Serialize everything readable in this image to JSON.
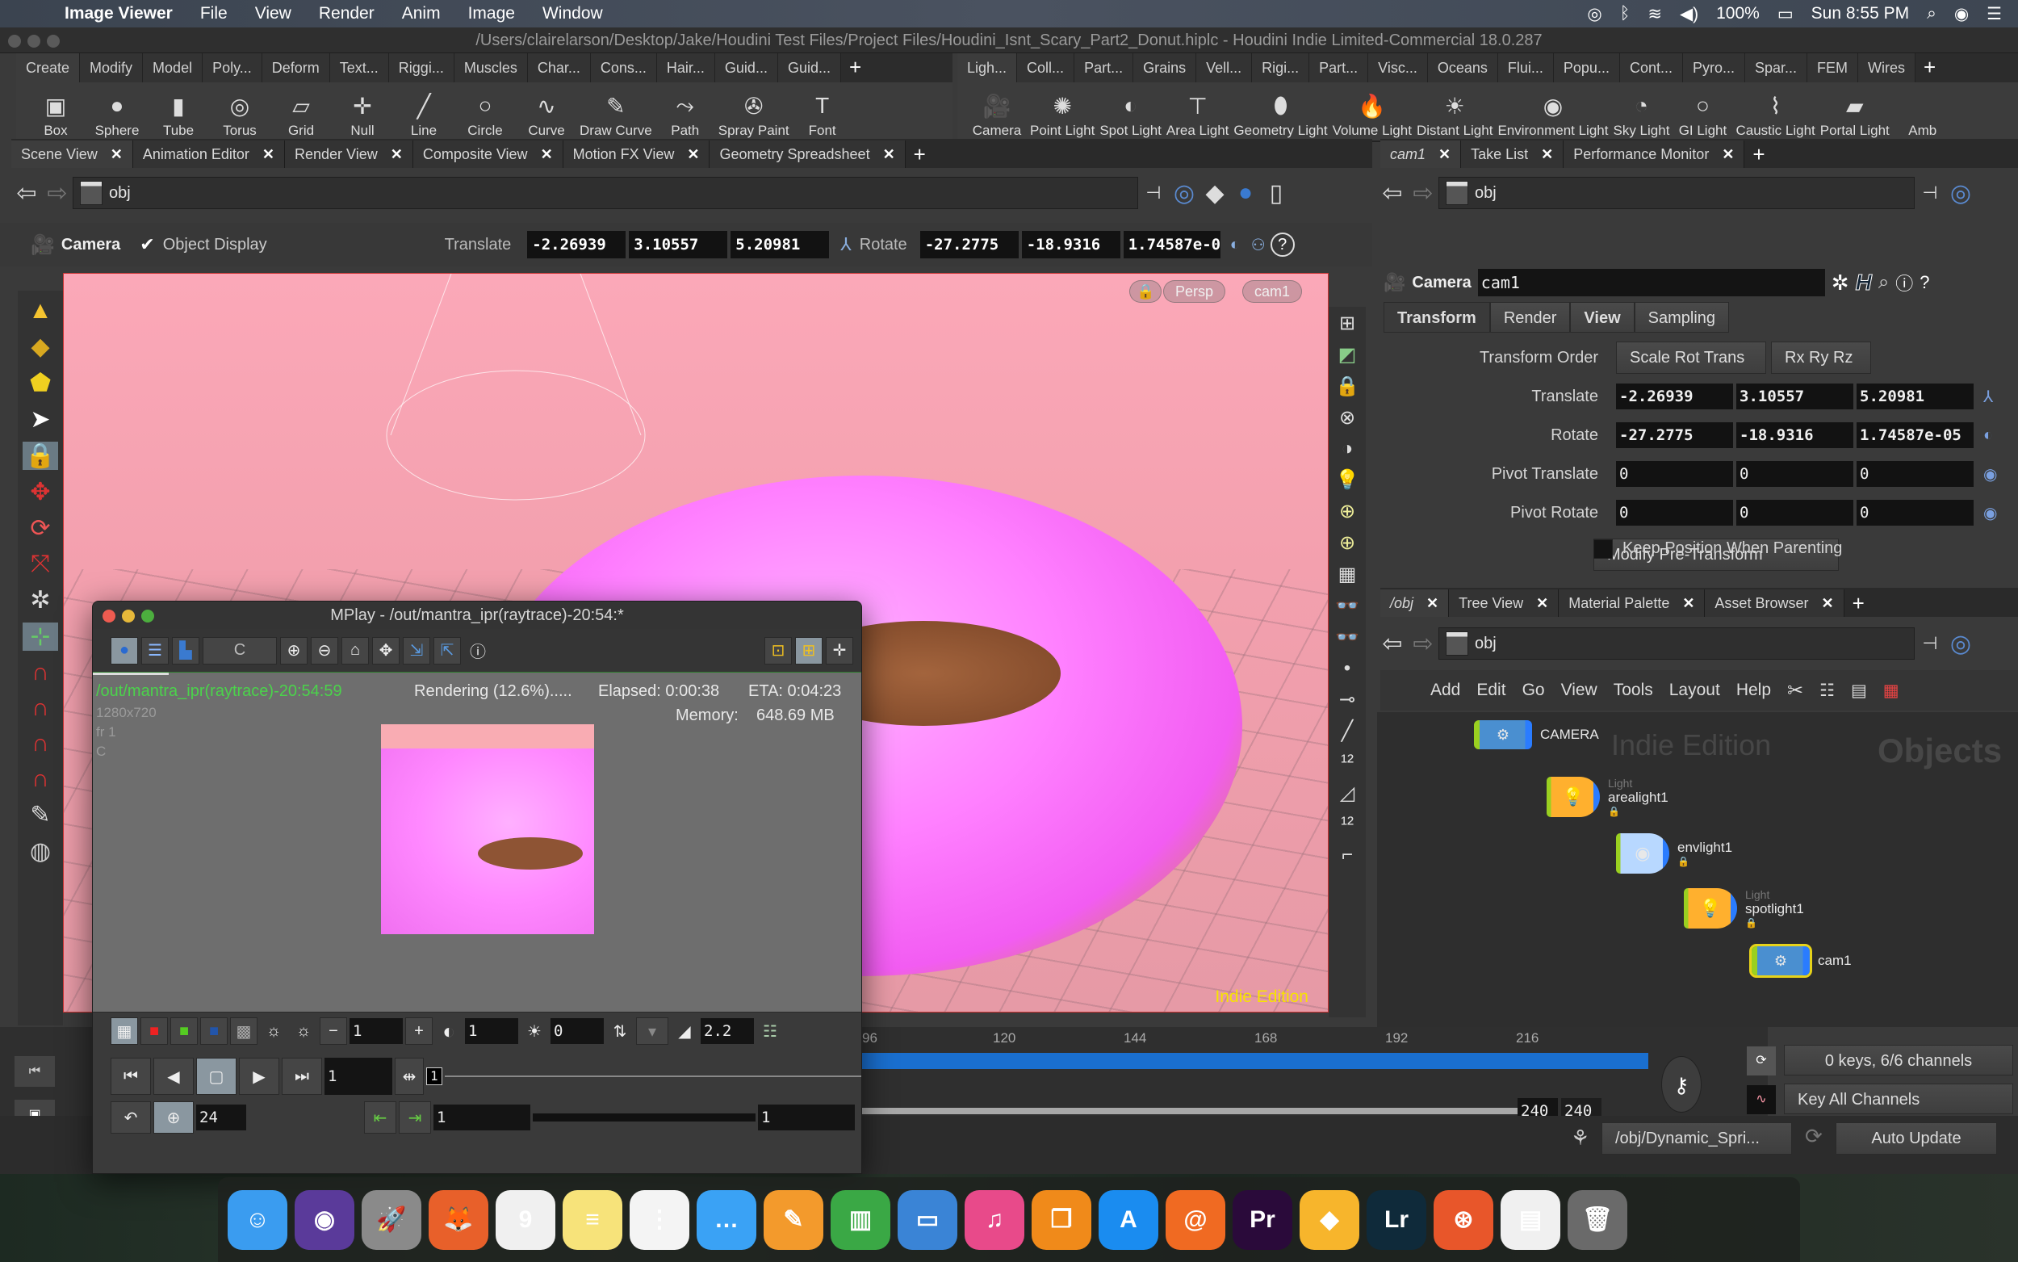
{
  "menubar": {
    "app_name": "Image Viewer",
    "items": [
      "File",
      "View",
      "Render",
      "Anim",
      "Image",
      "Window"
    ],
    "status": {
      "battery": "100%",
      "clock": "Sun 8:55 PM"
    },
    "icons": [
      "creative-cloud-icon",
      "bluetooth-icon",
      "wifi-icon",
      "volume-icon",
      "battery-icon",
      "spotlight-icon",
      "siri-icon",
      "control-center-icon"
    ]
  },
  "window": {
    "title": "/Users/clairelarson/Desktop/Jake/Houdini Test Files/Project Files/Houdini_Isnt_Scary_Part2_Donut.hiplc - Houdini Indie Limited-Commercial 18.0.287"
  },
  "shelf_left": {
    "tabs": [
      "Create",
      "Modify",
      "Model",
      "Poly...",
      "Deform",
      "Text...",
      "Riggi...",
      "Muscles",
      "Char...",
      "Cons...",
      "Hair...",
      "Guid...",
      "Guid..."
    ],
    "active_tab": "Create",
    "tools": [
      {
        "label": "Box",
        "icon": "box-icon",
        "glyph": "▣"
      },
      {
        "label": "Sphere",
        "icon": "sphere-icon",
        "glyph": "●"
      },
      {
        "label": "Tube",
        "icon": "tube-icon",
        "glyph": "▮"
      },
      {
        "label": "Torus",
        "icon": "torus-icon",
        "glyph": "◎"
      },
      {
        "label": "Grid",
        "icon": "grid-icon",
        "glyph": "▱"
      },
      {
        "label": "Null",
        "icon": "null-icon",
        "glyph": "✛"
      },
      {
        "label": "Line",
        "icon": "line-icon",
        "glyph": "╱"
      },
      {
        "label": "Circle",
        "icon": "circle-icon",
        "glyph": "○"
      },
      {
        "label": "Curve",
        "icon": "curve-icon",
        "glyph": "∿"
      },
      {
        "label": "Draw Curve",
        "icon": "draw-curve-icon",
        "glyph": "✎"
      },
      {
        "label": "Path",
        "icon": "path-icon",
        "glyph": "⤳"
      },
      {
        "label": "Spray Paint",
        "icon": "spray-paint-icon",
        "glyph": "✇"
      },
      {
        "label": "Font",
        "icon": "font-icon",
        "glyph": "T"
      }
    ]
  },
  "shelf_right": {
    "tabs": [
      "Ligh...",
      "Coll...",
      "Part...",
      "Grains",
      "Vell...",
      "Rigi...",
      "Part...",
      "Visc...",
      "Oceans",
      "Flui...",
      "Popu...",
      "Cont...",
      "Pyro...",
      "Spar...",
      "FEM",
      "Wires"
    ],
    "active_tab": "Ligh...",
    "tools": [
      {
        "label": "Camera",
        "icon": "camera-icon",
        "glyph": "🎥"
      },
      {
        "label": "Point Light",
        "icon": "point-light-icon",
        "glyph": "✺"
      },
      {
        "label": "Spot Light",
        "icon": "spot-light-icon",
        "glyph": "◐"
      },
      {
        "label": "Area Light",
        "icon": "area-light-icon",
        "glyph": "⊤"
      },
      {
        "label": "Geometry Light",
        "icon": "geometry-light-icon",
        "glyph": "⬮"
      },
      {
        "label": "Volume Light",
        "icon": "volume-light-icon",
        "glyph": "🔥"
      },
      {
        "label": "Distant Light",
        "icon": "distant-light-icon",
        "glyph": "☀"
      },
      {
        "label": "Environment Light",
        "icon": "environment-light-icon",
        "glyph": "◉"
      },
      {
        "label": "Sky Light",
        "icon": "sky-light-icon",
        "glyph": "◔"
      },
      {
        "label": "GI Light",
        "icon": "gi-light-icon",
        "glyph": "○"
      },
      {
        "label": "Caustic Light",
        "icon": "caustic-light-icon",
        "glyph": "⌇"
      },
      {
        "label": "Portal Light",
        "icon": "portal-light-icon",
        "glyph": "▰"
      },
      {
        "label": "Amb",
        "icon": "ambient-light-icon",
        "glyph": ""
      }
    ]
  },
  "scene_pane": {
    "tabs": [
      "Scene View",
      "Animation Editor",
      "Render View",
      "Composite View",
      "Motion FX View",
      "Geometry Spreadsheet"
    ],
    "active_tab": "Scene View",
    "path": "obj",
    "op_toolbar": {
      "type_label": "Camera",
      "object_display_label": "Object Display",
      "object_display_checked": true,
      "translate_label": "Translate",
      "translate": [
        "-2.26939",
        "3.10557",
        "5.20981"
      ],
      "rotate_label": "Rotate",
      "rotate": [
        "-27.2775",
        "-18.9316",
        "1.74587e-05"
      ]
    },
    "viewport": {
      "projection": "Persp",
      "camera": "cam1",
      "watermark": "Indie Edition"
    }
  },
  "param_pane": {
    "tabs": [
      "cam1",
      "Take List",
      "Performance Monitor"
    ],
    "active_tab": "cam1",
    "path": "obj",
    "node_type": "Camera",
    "node_name": "cam1",
    "subtabs": [
      "Transform",
      "Render",
      "View",
      "Sampling"
    ],
    "active_subtab": "Transform",
    "transform_order_label": "Transform Order",
    "transform_order": "Scale Rot Trans",
    "rotate_order": "Rx Ry Rz",
    "translate_label": "Translate",
    "translate": [
      "-2.26939",
      "3.10557",
      "5.20981"
    ],
    "rotate_label": "Rotate",
    "rotate": [
      "-27.2775",
      "-18.9316",
      "1.74587e-05"
    ],
    "pivot_translate_label": "Pivot Translate",
    "pivot_translate": [
      "0",
      "0",
      "0"
    ],
    "pivot_rotate_label": "Pivot Rotate",
    "pivot_rotate": [
      "0",
      "0",
      "0"
    ],
    "modify_pretransform": "Modify Pre-Transform",
    "keep_position_label": "Keep Position When Parenting",
    "keep_position_checked": false
  },
  "network_pane": {
    "tabs": [
      "/obj",
      "Tree View",
      "Material Palette",
      "Asset Browser"
    ],
    "active_tab": "/obj",
    "path": "obj",
    "menu": [
      "Add",
      "Edit",
      "Go",
      "View",
      "Tools",
      "Layout",
      "Help"
    ],
    "watermark": "Indie Edition",
    "context_label": "Objects",
    "nodes": [
      {
        "name": "CAMERA",
        "type": "camera",
        "sublabel": ""
      },
      {
        "name": "arealight1",
        "type": "light",
        "sublabel": "Light"
      },
      {
        "name": "envlight1",
        "type": "envlight",
        "sublabel": ""
      },
      {
        "name": "spotlight1",
        "type": "light",
        "sublabel": "Light"
      },
      {
        "name": "cam1",
        "type": "camera",
        "sublabel": "",
        "selected": true
      }
    ]
  },
  "timeline": {
    "ticks": [
      "96",
      "120",
      "144",
      "168",
      "192",
      "216"
    ],
    "start_frame": "240",
    "end_frame": "240",
    "keys_status": "0 keys, 6/6 channels",
    "key_mode": "Key All Channels",
    "dynamics_path": "/obj/Dynamic_Spri...",
    "update_mode": "Auto Update"
  },
  "mplay": {
    "title": "MPlay - /out/mantra_ipr(raytrace)-20:54:*",
    "channel": "C",
    "render_name": "/out/mantra_ipr(raytrace)-20:54:59",
    "status": "Rendering (12.6%).....",
    "progress_percent": 12.6,
    "elapsed": "Elapsed: 0:00:38",
    "eta": "ETA: 0:04:23",
    "memory_label": "Memory:",
    "memory": "648.69 MB",
    "resolution": "1280x720",
    "frame_label": "fr 1",
    "channel_label": "C",
    "exposure": "1",
    "gamma_field": "1",
    "offset": "0",
    "gamma": "2.2",
    "current_frame": "1",
    "frame_marker": "1",
    "fps": "24",
    "range_start": "1",
    "range_end": "1"
  },
  "colors": {
    "accent_blue": "#1a6fcf",
    "render_green": "#4bd34b",
    "indie_yellow": "#f7e300",
    "viewport_pink": "#f3a0ae"
  },
  "dock": {
    "apps": [
      {
        "name": "Finder",
        "icon": "finder-icon",
        "glyph": "☺",
        "color": "#3a9cf0"
      },
      {
        "name": "Siri",
        "icon": "siri-icon",
        "glyph": "◉",
        "color": "#5a3a9a"
      },
      {
        "name": "Launchpad",
        "icon": "launchpad-icon",
        "glyph": "🚀",
        "color": "#8a8a8a"
      },
      {
        "name": "Firefox",
        "icon": "firefox-icon",
        "glyph": "🦊",
        "color": "#e8602a"
      },
      {
        "name": "Calendar",
        "icon": "calendar-icon",
        "glyph": "9",
        "color": "#f0f0f0"
      },
      {
        "name": "Notes",
        "icon": "notes-icon",
        "glyph": "≡",
        "color": "#f7e37a"
      },
      {
        "name": "Reminders",
        "icon": "reminders-icon",
        "glyph": "⋮",
        "color": "#f4f4f4"
      },
      {
        "name": "Messages",
        "icon": "messages-icon",
        "glyph": "…",
        "color": "#3aa2f5"
      },
      {
        "name": "Pages",
        "icon": "pages-icon",
        "glyph": "✎",
        "color": "#f39a2c"
      },
      {
        "name": "Numbers",
        "icon": "numbers-icon",
        "glyph": "▥",
        "color": "#3aa845"
      },
      {
        "name": "Keynote",
        "icon": "keynote-icon",
        "glyph": "▭",
        "color": "#3a84d6"
      },
      {
        "name": "iTunes",
        "icon": "itunes-icon",
        "glyph": "♫",
        "color": "#e84a8a"
      },
      {
        "name": "Books",
        "icon": "books-icon",
        "glyph": "❐",
        "color": "#f08a1a"
      },
      {
        "name": "App Store",
        "icon": "app-store-icon",
        "glyph": "A",
        "color": "#1a8cf0"
      },
      {
        "name": "Houdini",
        "icon": "houdini-icon",
        "glyph": "@",
        "color": "#f06a22"
      },
      {
        "name": "Premiere Pro",
        "icon": "premiere-icon",
        "glyph": "Pr",
        "color": "#2a0a3a"
      },
      {
        "name": "Sketch",
        "icon": "sketch-icon",
        "glyph": "◆",
        "color": "#f7b52c"
      },
      {
        "name": "Lightroom",
        "icon": "lightroom-icon",
        "glyph": "Lr",
        "color": "#0f2a3a"
      },
      {
        "name": "Houdini FX",
        "icon": "houdini-fx-icon",
        "glyph": "⊛",
        "color": "#e8562a"
      },
      {
        "name": "Document",
        "icon": "document-icon",
        "glyph": "▤",
        "color": "#f0f0f0"
      },
      {
        "name": "Trash",
        "icon": "trash-icon",
        "glyph": "🗑",
        "color": "#6a6a6a"
      }
    ]
  }
}
